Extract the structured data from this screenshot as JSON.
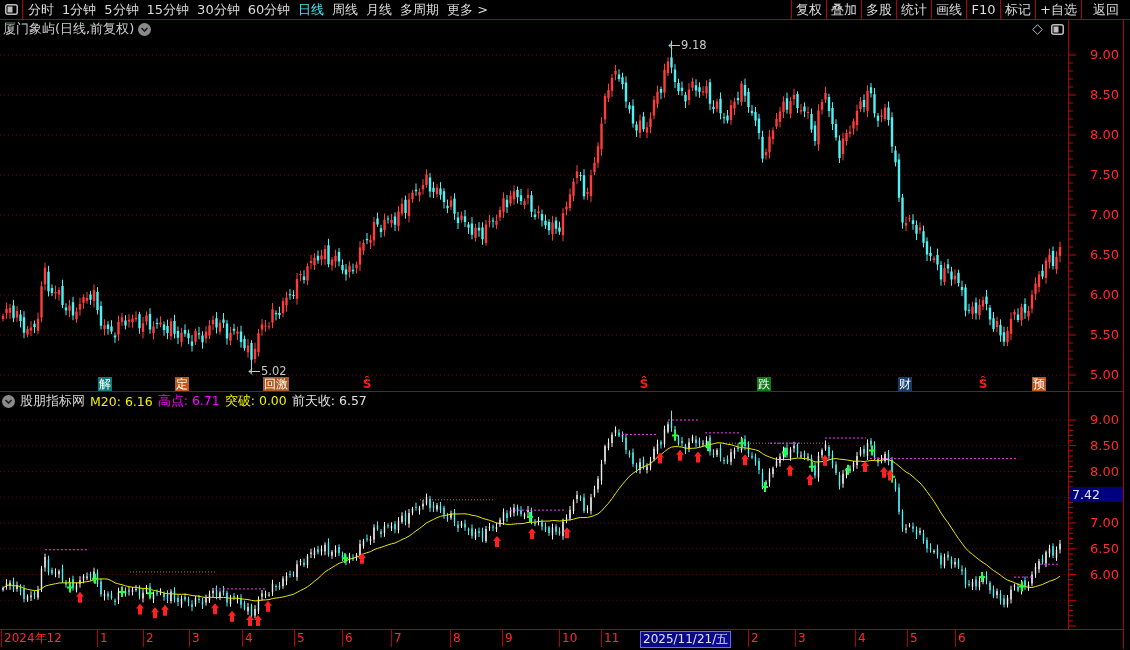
{
  "toolbar": {
    "period_tabs": [
      {
        "label": "分时",
        "selected": false
      },
      {
        "label": "1分钟",
        "selected": false
      },
      {
        "label": "5分钟",
        "selected": false
      },
      {
        "label": "15分钟",
        "selected": false
      },
      {
        "label": "30分钟",
        "selected": false
      },
      {
        "label": "60分钟",
        "selected": false
      },
      {
        "label": "日线",
        "selected": true
      },
      {
        "label": "周线",
        "selected": false
      },
      {
        "label": "月线",
        "selected": false
      },
      {
        "label": "多周期",
        "selected": false
      },
      {
        "label": "更多 >",
        "selected": false
      }
    ],
    "buttons": [
      "复权",
      "叠加",
      "多股",
      "统计",
      "画线",
      "F10",
      "标记",
      "+自选",
      "返回"
    ]
  },
  "main_chart": {
    "title": "厦门象屿(日线,前复权)",
    "high_label": "9.18",
    "low_label": "5.02",
    "y_ticks": [
      "9.00",
      "8.50",
      "8.00",
      "7.50",
      "7.00",
      "6.50",
      "6.00",
      "5.50",
      "5.00"
    ],
    "events": [
      {
        "kind": "badge",
        "label": "解",
        "color": "#0e7c7b"
      },
      {
        "kind": "badge",
        "label": "定",
        "color": "#c0571a"
      },
      {
        "kind": "badge",
        "label": "回激",
        "color": "#a85a22"
      },
      {
        "kind": "sign",
        "label": "Ŝ",
        "color": "#ff1a1a"
      },
      {
        "kind": "sign",
        "label": "Ŝ",
        "color": "#ff1a1a"
      },
      {
        "kind": "badge",
        "label": "跌",
        "color": "#0b7d14"
      },
      {
        "kind": "badge",
        "label": "财",
        "color": "#163a6a"
      },
      {
        "kind": "sign",
        "label": "Ŝ",
        "color": "#ff1a1a"
      },
      {
        "kind": "badge",
        "label": "预",
        "color": "#c0571a"
      }
    ]
  },
  "indicator": {
    "name": "股朋指标网",
    "readings": [
      {
        "text": "M20: 6.16",
        "color": "#f0f000"
      },
      {
        "text": "高点: 6.71",
        "color": "#ff00ff"
      },
      {
        "text": "突破: 0.00",
        "color": "#f0f000"
      },
      {
        "text": "前天收: 6.57",
        "color": "#e0e0e0"
      }
    ],
    "y_ticks": [
      "9.00",
      "8.50",
      "8.00",
      "7.00",
      "6.50",
      "6.00"
    ],
    "current_price": "7.42"
  },
  "time_axis": {
    "labels": [
      "2024年12",
      "1",
      "2",
      "3",
      "4",
      "5",
      "6",
      "7",
      "8",
      "9",
      "10",
      "11",
      "2",
      "3",
      "4",
      "5",
      "6"
    ],
    "cursor_date": "2025/11/21/五"
  }
}
